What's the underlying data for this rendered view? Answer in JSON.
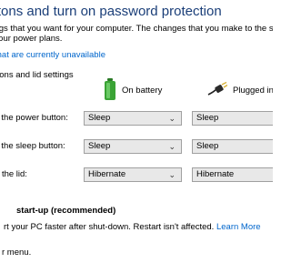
{
  "header": {
    "title": "buttons and turn on password protection",
    "intro_line1": "settings that you want for your computer. The changes that you make to the settings",
    "intro_line2": "ll of your power plans."
  },
  "unavailable_link": "that are currently unavailable",
  "section": {
    "heading": "ttons and lid settings"
  },
  "columns": {
    "battery": {
      "label": "On battery",
      "icon": "battery-icon"
    },
    "plugged": {
      "label": "Plugged in",
      "icon": "power-plug-icon"
    }
  },
  "rows": [
    {
      "label": "ess the power button:",
      "battery": "Sleep",
      "plugged": "Sleep"
    },
    {
      "label": "ess the sleep button:",
      "battery": "Sleep",
      "plugged": "Sleep"
    },
    {
      "label": "ose the lid:",
      "battery": "Hibernate",
      "plugged": "Hibernate"
    }
  ],
  "startup": {
    "heading": "start-up (recommended)",
    "text": "rt your PC faster after shut-down. Restart isn't affected.",
    "learn_more": "Learn More"
  },
  "bottom": {
    "text": "r menu."
  },
  "colors": {
    "title": "#1a3e78",
    "link": "#0066cc",
    "select_bg": "#e8e8e8",
    "battery_green": "#3aa335"
  }
}
